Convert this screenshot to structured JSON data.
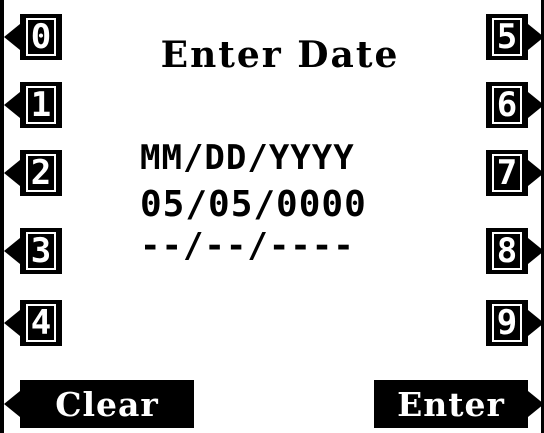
{
  "screen": {
    "title": "Enter Date",
    "format_hint": "MM/DD/YYYY",
    "current_value": "05/05/0000",
    "entry_field": "--/--/----"
  },
  "keys_left": [
    {
      "label": "0"
    },
    {
      "label": "1"
    },
    {
      "label": "2"
    },
    {
      "label": "3"
    },
    {
      "label": "4"
    }
  ],
  "keys_right": [
    {
      "label": "5"
    },
    {
      "label": "6"
    },
    {
      "label": "7"
    },
    {
      "label": "8"
    },
    {
      "label": "9"
    }
  ],
  "bottom": {
    "clear_label": "Clear",
    "enter_label": "Enter"
  },
  "colors": {
    "background": "#ffffff",
    "foreground": "#000000"
  }
}
